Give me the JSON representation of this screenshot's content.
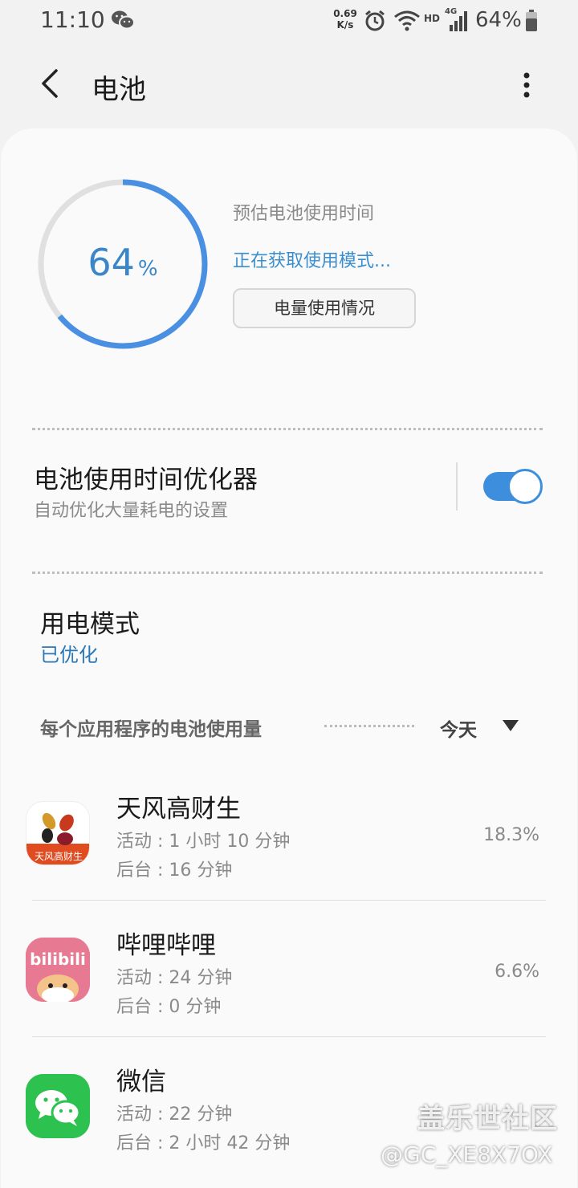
{
  "status_bar": {
    "time": "11:10",
    "net_speed_value": "0.69",
    "net_speed_unit": "K/s",
    "network_label": "HD",
    "network_gen": "4G",
    "battery_percent": "64%",
    "icons": [
      "wechat-icon",
      "alarm-icon",
      "wifi-icon",
      "signal-icon",
      "battery-icon"
    ]
  },
  "header": {
    "title": "电池",
    "back_icon": "back-arrow-icon",
    "more_icon": "more-vert-icon"
  },
  "battery": {
    "level": 64,
    "level_text": "64",
    "unit": "%",
    "estimated_label": "预估电池使用时间",
    "mode_status": "正在获取使用模式...",
    "usage_button": "电量使用情况",
    "ring_color": "#4a90e2"
  },
  "optimizer": {
    "title": "电池使用时间优化器",
    "subtitle": "自动优化大量耗电的设置",
    "enabled": true
  },
  "power_mode": {
    "title": "用电模式",
    "value": "已优化"
  },
  "per_app": {
    "label": "每个应用程序的电池使用量",
    "period": "今天",
    "apps": [
      {
        "name": "天风高财生",
        "active": "活动 : 1 小时 10 分钟",
        "background": "后台 : 16 分钟",
        "percent": "18.3%",
        "icon": "tianfeng-app-icon",
        "icon_text": "天风高财生"
      },
      {
        "name": "哔哩哔哩",
        "active": "活动 : 24 分钟",
        "background": "后台 : 0 分钟",
        "percent": "6.6%",
        "icon": "bilibili-app-icon",
        "icon_text": "bilibili"
      },
      {
        "name": "微信",
        "active": "活动 : 22 分钟",
        "background": "后台 : 2 小时 42 分钟",
        "percent": "",
        "icon": "wechat-app-icon"
      }
    ]
  },
  "watermark": {
    "community": "盖乐世社区",
    "user": "@GC_XE8X7OX"
  }
}
